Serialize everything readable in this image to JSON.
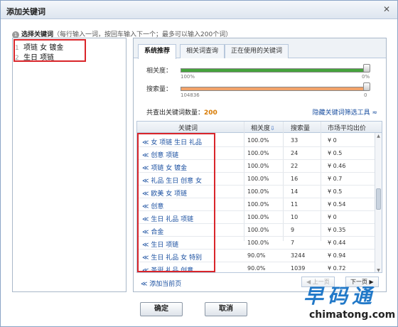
{
  "dialog": {
    "title": "添加关键词"
  },
  "instruction": {
    "step": "1",
    "label": "选择关键词",
    "hint": "（每行输入一词，按回车输入下一个；最多可以输入200个词）"
  },
  "left_list": {
    "lines": [
      {
        "num": "1",
        "text": "项链 女 镀金"
      },
      {
        "num": "2",
        "text": "生日 项链"
      }
    ]
  },
  "tabs": [
    {
      "label": "系统推荐",
      "active": true
    },
    {
      "label": "相关词查询",
      "active": false
    },
    {
      "label": "正在使用的关键词",
      "active": false
    }
  ],
  "relevance": {
    "label": "相关度：",
    "min": "100%",
    "max": "0%"
  },
  "search_volume": {
    "label": "搜索量：",
    "min": "104836",
    "max": "0"
  },
  "summary": {
    "prefix": "共查出关键词数量：",
    "count": "200",
    "hide_link": "隐藏关键词筛选工具 ≈"
  },
  "table": {
    "headers": {
      "keyword": "关键词",
      "relevance": "相关度",
      "search": "搜索量",
      "price": "市场平均出价"
    },
    "rows": [
      {
        "kw": "女 项链 生日 礼品",
        "rel": "100.0%",
        "vol": "33",
        "price": "¥ 0"
      },
      {
        "kw": "创意 项链",
        "rel": "100.0%",
        "vol": "24",
        "price": "¥ 0.5"
      },
      {
        "kw": "项链 女 镀金",
        "rel": "100.0%",
        "vol": "22",
        "price": "¥ 0.46"
      },
      {
        "kw": "礼品 生日 创意 女",
        "rel": "100.0%",
        "vol": "16",
        "price": "¥ 0.7"
      },
      {
        "kw": "欧美 女 项链",
        "rel": "100.0%",
        "vol": "14",
        "price": "¥ 0.5"
      },
      {
        "kw": "创意",
        "rel": "100.0%",
        "vol": "11",
        "price": "¥ 0.54"
      },
      {
        "kw": "生日 礼品 项链",
        "rel": "100.0%",
        "vol": "10",
        "price": "¥ 0"
      },
      {
        "kw": "合金",
        "rel": "100.0%",
        "vol": "9",
        "price": "¥ 0.35"
      },
      {
        "kw": "生日 项链",
        "rel": "100.0%",
        "vol": "7",
        "price": "¥ 0.44"
      },
      {
        "kw": "生日 礼品 女 特别",
        "rel": "90.0%",
        "vol": "3244",
        "price": "¥ 0.94"
      },
      {
        "kw": "圣诞 礼品 创意",
        "rel": "90.0%",
        "vol": "1039",
        "price": "¥ 0.72"
      }
    ],
    "add_page": "添加当前页",
    "prev": "◀ 上一页",
    "next": "下一页 ▶"
  },
  "buttons": {
    "ok": "确定",
    "cancel": "取消"
  },
  "watermark": {
    "cn": "早码通",
    "en": "chimatong.com"
  },
  "colors": {
    "relevance_bar": "#45a33c",
    "search_bar": "#f2a36a",
    "link": "#1a4fa0",
    "highlight_frame": "#d9252a",
    "count": "#d87a00"
  }
}
